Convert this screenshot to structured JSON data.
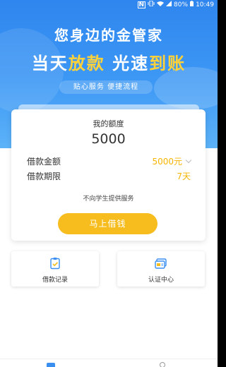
{
  "status_bar": {
    "nfc": "N",
    "battery_percent": "80%",
    "time": "10:49"
  },
  "banner": {
    "headline1": "您身边的金管家",
    "headline2_part1": "当天",
    "headline2_part2": "放款",
    "headline2_part3": " 光速",
    "headline2_part4": "到账",
    "tagline": "贴心服务 便捷流程"
  },
  "quota_card": {
    "label": "我的额度",
    "value": "5000",
    "amount_label": "借款金额",
    "amount_value": "5000元",
    "term_label": "借款期限",
    "term_value": "7天",
    "notice": "不向学生提供服务",
    "button_label": "马上借钱"
  },
  "shortcuts": [
    {
      "label": "借款记录",
      "icon": "clipboard-check-icon"
    },
    {
      "label": "认证中心",
      "icon": "id-card-icon"
    }
  ],
  "colors": {
    "banner_blue": "#3d98f5",
    "accent_yellow": "#f7bd1e",
    "value_yellow": "#f5b400"
  }
}
